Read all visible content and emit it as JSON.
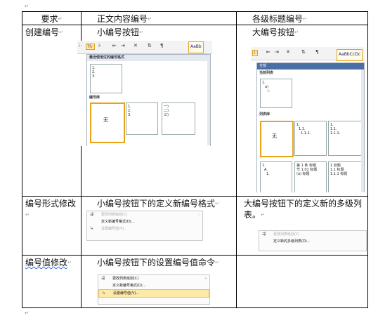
{
  "marks": {
    "paragraph": "↵"
  },
  "table": {
    "headers": [
      "要求",
      "正文内容编号",
      "各级标题编号"
    ],
    "rows": [
      {
        "req": "创建编号",
        "body": "小编号按钮",
        "heading": "大编号按钮"
      },
      {
        "req": "编号形式修改",
        "body": "小编号按钮下的定义新编号格式",
        "heading": "大编号按钮下的定义新的多级列表。"
      },
      {
        "req": "编号值修改",
        "body": "小编号按钮下的设置编号值命令",
        "heading": ""
      }
    ]
  },
  "small_button_shot": {
    "style_preview": "AaBb",
    "panel_title": "最近使用过的编号格式",
    "recent": [
      "1.",
      "2.",
      "3."
    ],
    "library_title": "编号库",
    "none_label": "无",
    "lib_a": [
      "1.",
      "2.",
      "3."
    ],
    "lib_b": [
      "一)",
      "二)",
      "三)"
    ]
  },
  "big_button_shot": {
    "style_preview": "AaBbCcDc",
    "dropdown_label": "全部",
    "current_title": "当前列表",
    "current": [
      "1.",
      "a)",
      "i."
    ],
    "list_library_title": "列表库",
    "none_label": "无",
    "lib_a": [
      "1.",
      "1.1.",
      "1.1.1."
    ],
    "lib_b": [
      "1.",
      "1.1.",
      "1.1.1."
    ],
    "lib_c": [
      "1.",
      "A.",
      "1."
    ],
    "lib_d": [
      "第 1 条 标题",
      "节 1.01 标题",
      "(a) 标题"
    ],
    "lib_e": [
      "1 标题",
      "1.1 标题",
      "1.1.1 标题"
    ]
  },
  "menu_small_define": {
    "items": [
      "更改列表级别(C)",
      "定义新编号格式(D)...",
      "设置编号值(V)..."
    ]
  },
  "menu_big_define": {
    "items": [
      "更改列表级别(C)",
      "定义新的多级列表(D)..."
    ]
  },
  "menu_set_value": {
    "items": [
      "更改列表级别(C)",
      "定义新编号格式(D)...",
      "设置编号值(V)..."
    ]
  }
}
